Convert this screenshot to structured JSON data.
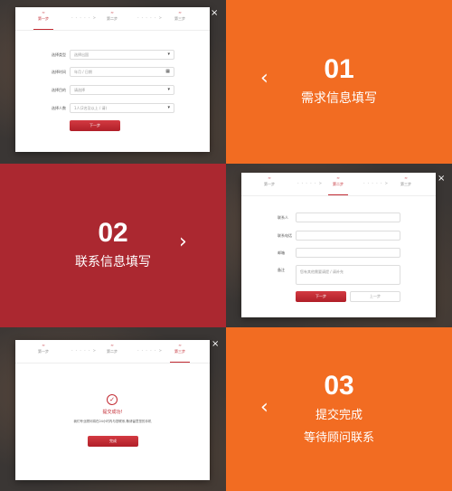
{
  "stepper": {
    "step1": "第一步",
    "step2": "第二步",
    "step3": "第三步",
    "step_icon": "≈",
    "separator": "- - - - - >"
  },
  "close_glyph": "×",
  "form1": {
    "rows": [
      {
        "label": "选择类型",
        "value": "选择出国",
        "control": "select"
      },
      {
        "label": "选择时间",
        "value": "年月 / 日期",
        "control": "date"
      },
      {
        "label": "选择目的",
        "value": "请选择",
        "control": "select"
      },
      {
        "label": "选择人数",
        "value": "1人(2名及以上 / 请)",
        "control": "select"
      }
    ],
    "next_label": "下一步"
  },
  "panel1": {
    "num": "01",
    "text": "需求信息填写",
    "arrow": "‹"
  },
  "panel2": {
    "num": "02",
    "text": "联系信息填写",
    "arrow": "›"
  },
  "form2": {
    "rows": [
      {
        "label": "联系人",
        "value": ""
      },
      {
        "label": "联系电话",
        "value": ""
      },
      {
        "label": "邮箱",
        "value": ""
      },
      {
        "label": "备注",
        "value": "您有其他需要请提 / 请补充"
      }
    ],
    "next_label": "下一步",
    "prev_label": "上一步"
  },
  "success": {
    "icon": "✓",
    "title": "提交成功!",
    "message": "我们专业顾问将在24小时内与您联系,敬请留意您的手机",
    "done_label": "完成"
  },
  "panel3": {
    "num": "03",
    "line1": "提交完成",
    "line2": "等待顾问联系",
    "arrow": "‹"
  },
  "colors": {
    "orange": "#f26c22",
    "red": "#ab2830",
    "accent": "#c22a32"
  }
}
